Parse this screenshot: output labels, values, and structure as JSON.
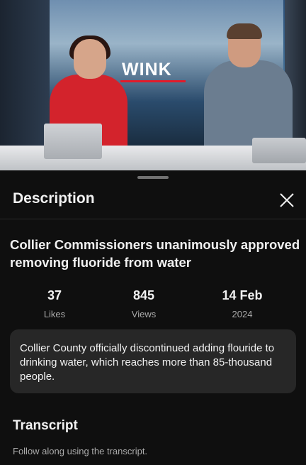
{
  "video": {
    "logo_text": "WINK"
  },
  "sheet": {
    "title": "Description",
    "close_icon": "close-icon"
  },
  "video_info": {
    "title": "Collier Commissioners unanimously approved removing fluoride from water",
    "stats": [
      {
        "value": "37",
        "label": "Likes"
      },
      {
        "value": "845",
        "label": "Views"
      },
      {
        "value": "14 Feb",
        "label": "2024"
      }
    ],
    "description": "Collier County officially discontinued adding flouride to drinking water, which reaches more than 85-thousand people."
  },
  "transcript": {
    "title": "Transcript",
    "subtitle": "Follow along using the transcript."
  },
  "colors": {
    "background": "#0f0f0f",
    "card": "#272727",
    "secondary_text": "#aaaaaa",
    "brand_accent": "#e21b2a"
  }
}
